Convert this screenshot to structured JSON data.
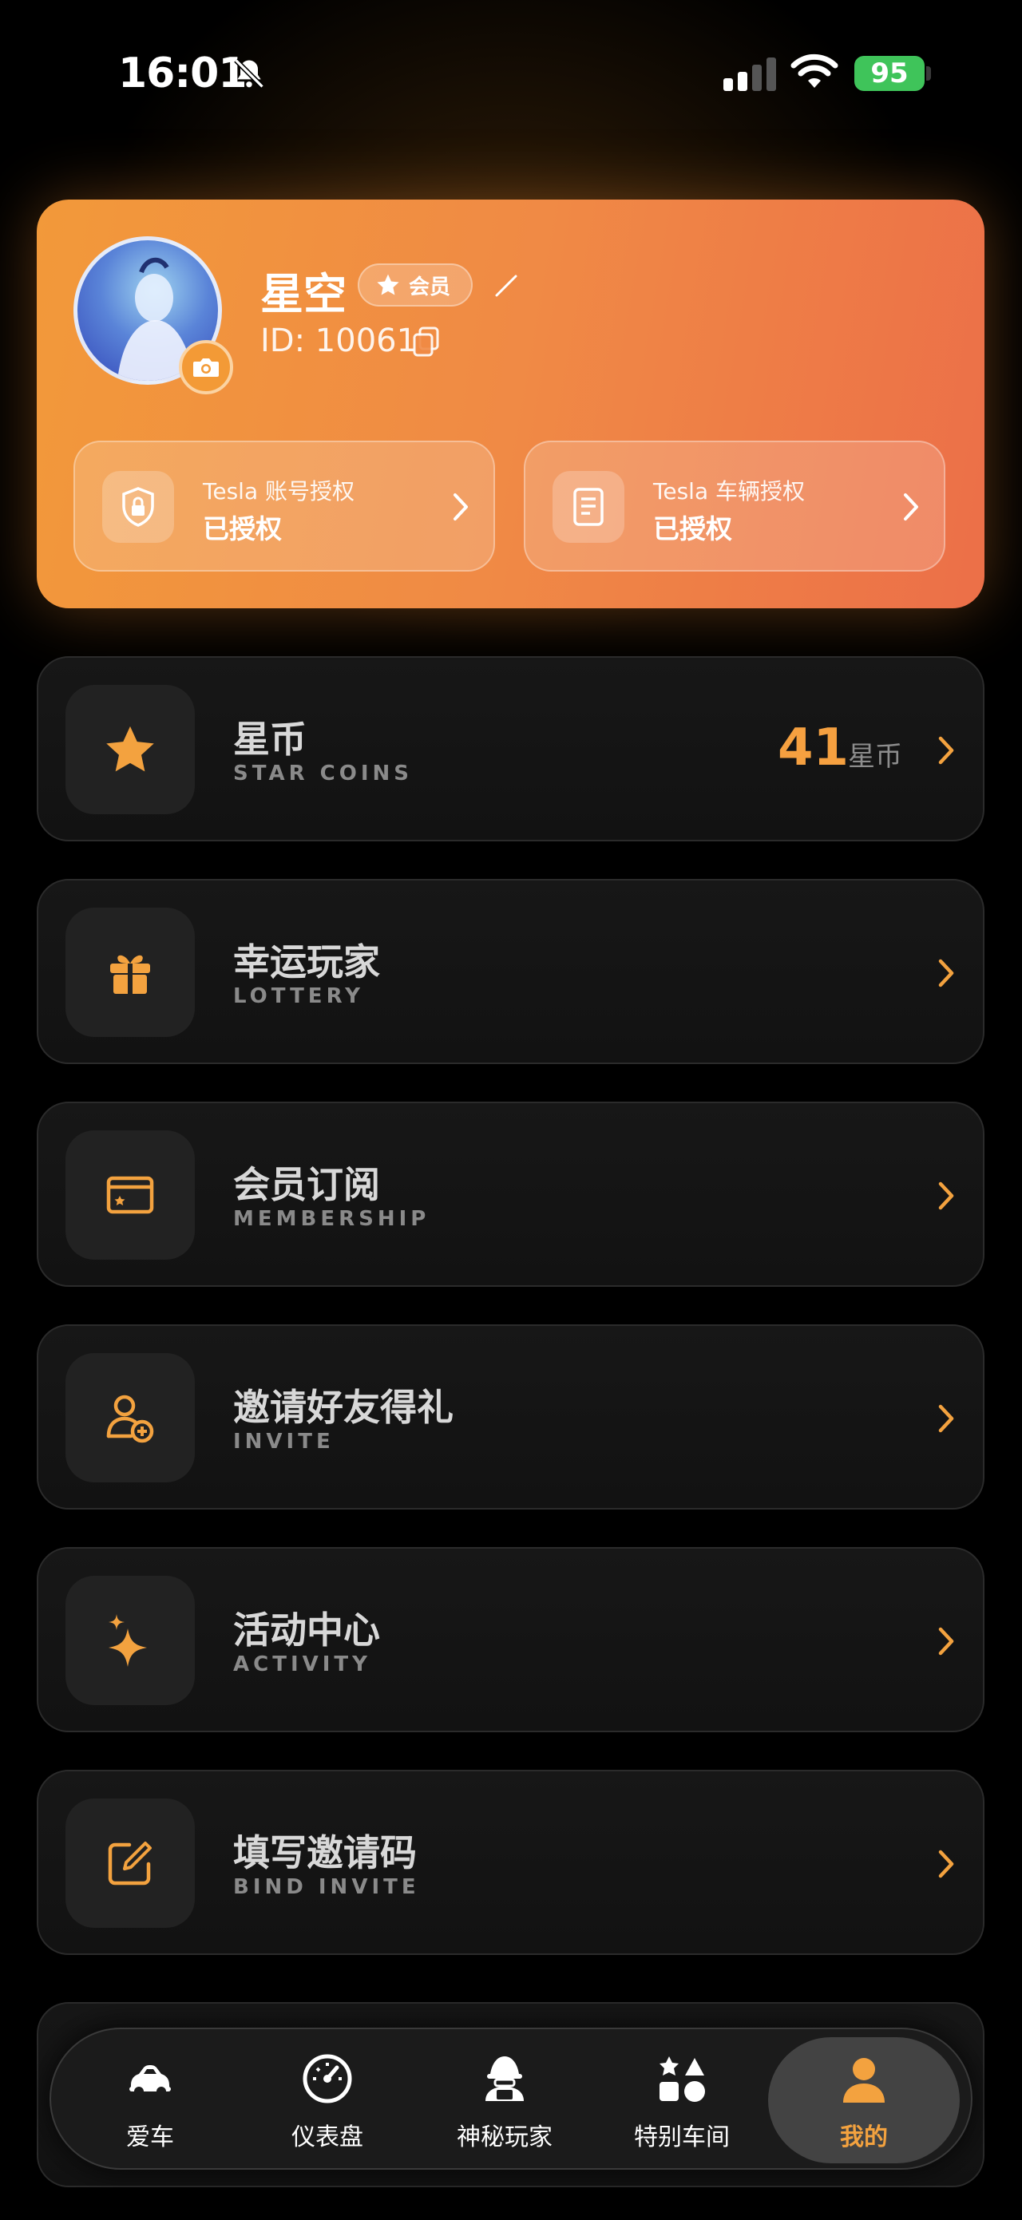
{
  "status_bar": {
    "time": "16:01",
    "battery": "95"
  },
  "profile": {
    "username": "星空",
    "badge_label": "会员",
    "user_id": "ID: 10061",
    "auth_tiles": [
      {
        "title": "Tesla 账号授权",
        "status": "已授权",
        "icon": "lock-shield-icon"
      },
      {
        "title": "Tesla 车辆授权",
        "status": "已授权",
        "icon": "document-icon"
      }
    ]
  },
  "menu": [
    {
      "title": "星币",
      "subtitle": "STAR COINS",
      "icon": "star-icon",
      "value": "41",
      "unit": "星币"
    },
    {
      "title": "幸运玩家",
      "subtitle": "LOTTERY",
      "icon": "gift-icon"
    },
    {
      "title": "会员订阅",
      "subtitle": "MEMBERSHIP",
      "icon": "card-icon"
    },
    {
      "title": "邀请好友得礼",
      "subtitle": "INVITE",
      "icon": "add-user-icon"
    },
    {
      "title": "活动中心",
      "subtitle": "ACTIVITY",
      "icon": "sparkles-icon"
    },
    {
      "title": "填写邀请码",
      "subtitle": "BIND INVITE",
      "icon": "edit-box-icon"
    }
  ],
  "tabs": [
    {
      "label": "爱车",
      "icon": "car-icon"
    },
    {
      "label": "仪表盘",
      "icon": "speedometer-icon"
    },
    {
      "label": "神秘玩家",
      "icon": "hacker-icon"
    },
    {
      "label": "特别车间",
      "icon": "shapes-icon"
    },
    {
      "label": "我的",
      "icon": "person-icon",
      "active": true
    }
  ],
  "colors": {
    "accent": "#f3a23f",
    "card_gradient_start": "#f2993a",
    "card_gradient_end": "#ec6f48",
    "battery": "#3fc45a"
  }
}
